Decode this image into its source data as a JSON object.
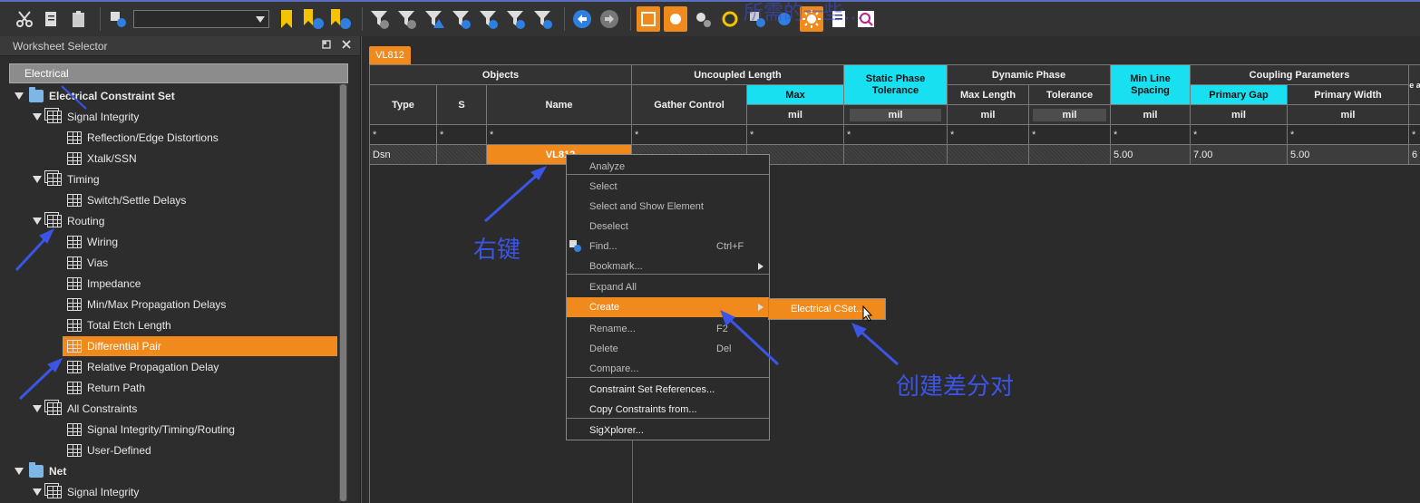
{
  "toolbar": {
    "combo_value": "",
    "overlay_text": "所需的一些…"
  },
  "left_panel": {
    "title": "Worksheet Selector",
    "category": "Electrical",
    "tree": [
      {
        "label": "Electrical Constraint Set",
        "level": 0,
        "kind": "folder",
        "bold": true
      },
      {
        "label": "Signal Integrity",
        "level": 1,
        "kind": "group"
      },
      {
        "label": "Reflection/Edge Distortions",
        "level": 2,
        "kind": "sheet"
      },
      {
        "label": "Xtalk/SSN",
        "level": 2,
        "kind": "sheet"
      },
      {
        "label": "Timing",
        "level": 1,
        "kind": "group"
      },
      {
        "label": "Switch/Settle Delays",
        "level": 2,
        "kind": "sheet"
      },
      {
        "label": "Routing",
        "level": 1,
        "kind": "group"
      },
      {
        "label": "Wiring",
        "level": 2,
        "kind": "sheet"
      },
      {
        "label": "Vias",
        "level": 2,
        "kind": "sheet"
      },
      {
        "label": "Impedance",
        "level": 2,
        "kind": "sheet"
      },
      {
        "label": "Min/Max Propagation Delays",
        "level": 2,
        "kind": "sheet"
      },
      {
        "label": "Total Etch Length",
        "level": 2,
        "kind": "sheet"
      },
      {
        "label": "Differential Pair",
        "level": 2,
        "kind": "sheet",
        "selected": true
      },
      {
        "label": "Relative Propagation Delay",
        "level": 2,
        "kind": "sheet"
      },
      {
        "label": "Return Path",
        "level": 2,
        "kind": "sheet"
      },
      {
        "label": "All Constraints",
        "level": 1,
        "kind": "group"
      },
      {
        "label": "Signal Integrity/Timing/Routing",
        "level": 2,
        "kind": "sheet"
      },
      {
        "label": "User-Defined",
        "level": 2,
        "kind": "sheet"
      },
      {
        "label": "Net",
        "level": 0,
        "kind": "folder",
        "bold": true
      },
      {
        "label": "Signal Integrity",
        "level": 1,
        "kind": "group"
      }
    ]
  },
  "worksheet": {
    "tab": "VL812",
    "group_headers": {
      "objects": "Objects",
      "uncoupled_length": "Uncoupled Length",
      "static_phase_tolerance": "Static Phase Tolerance",
      "dynamic_phase": "Dynamic Phase",
      "min_line_spacing": "Min Line Spacing",
      "coupling_parameters": "Coupling Parameters",
      "cut": "e a"
    },
    "columns": {
      "type": "Type",
      "s": "S",
      "name": "Name",
      "gather_control": "Gather Control",
      "max": "Max",
      "max_length": "Max Length",
      "tolerance": "Tolerance",
      "primary_gap": "Primary Gap",
      "primary_width": "Primary Width"
    },
    "unit": "mil",
    "filter_char": "*",
    "row": {
      "type": "Dsn",
      "name": "VL812",
      "min_line_spacing": "5.00",
      "primary_gap": "7.00",
      "primary_width": "5.00",
      "cut": "6"
    }
  },
  "context_menu": {
    "items": [
      {
        "label": "Analyze"
      },
      {
        "label": "Select"
      },
      {
        "label": "Select and Show Element"
      },
      {
        "label": "Deselect"
      },
      {
        "label": "Find...",
        "shortcut": "Ctrl+F"
      },
      {
        "label": "Bookmark...",
        "submenu": true
      },
      {
        "label": "Expand All"
      },
      {
        "label": "Create",
        "submenu": true
      },
      {
        "label": "Rename...",
        "shortcut": "F2"
      },
      {
        "label": "Delete",
        "shortcut": "Del"
      },
      {
        "label": "Compare..."
      },
      {
        "label": "Constraint Set References..."
      },
      {
        "label": "Copy Constraints from..."
      },
      {
        "label": "SigXplorer..."
      }
    ],
    "submenu_item": "Electrical CSet..."
  },
  "annotations": {
    "right_click": "右键",
    "create_diff_pair": "创建差分对"
  },
  "colors": {
    "accent_orange": "#f08a1c",
    "header_cyan": "#19e0f0",
    "annotation_blue": "#3b55e6"
  }
}
